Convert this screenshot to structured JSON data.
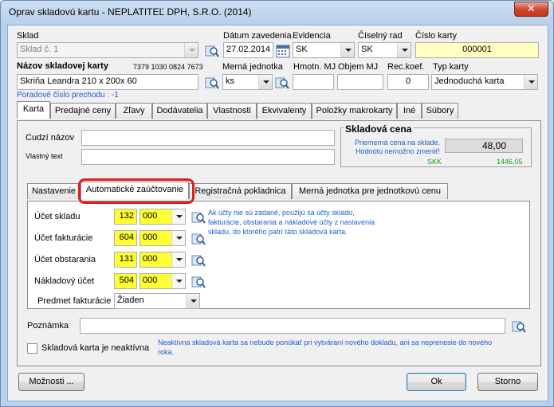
{
  "window": {
    "title": "Oprav skladovú kartu - NEPLATITEĽ DPH, S.R.O. (2014)",
    "close_glyph": "✕"
  },
  "header": {
    "sklad": {
      "label": "Sklad",
      "value": "Sklad č. 1"
    },
    "datum": {
      "label": "Dátum zavedenia",
      "value": "27.02.2014"
    },
    "evidencia": {
      "label": "Evidencia",
      "value": "SK"
    },
    "ciselny_rad": {
      "label": "Číselný rad",
      "value": "SK"
    },
    "cislo_karty": {
      "label": "Číslo karty",
      "value": "000001"
    },
    "nazov": {
      "label": "Názov skladovej karty",
      "barcode": "7379 1030 0824 7673",
      "value": "Skriňa Leandra 210 x 200x 60"
    },
    "merna_jednotka": {
      "label": "Merná jednotka",
      "value": "ks"
    },
    "hmotn_mj": {
      "label": "Hmotn. MJ",
      "value": ""
    },
    "objem_mj": {
      "label": "Objem MJ",
      "value": ""
    },
    "rec_koef": {
      "label": "Rec.koef.",
      "value": "0"
    },
    "typ_karty": {
      "label": "Typ karty",
      "value": "Jednoduchá karta"
    },
    "poradove_cislo": "Poradové číslo prechodu : -1"
  },
  "tabs": [
    {
      "label": "Karta"
    },
    {
      "label": "Predajné ceny"
    },
    {
      "label": "Zľavy"
    },
    {
      "label": "Dodávatelia"
    },
    {
      "label": "Vlastnosti"
    },
    {
      "label": "Ekvivalenty"
    },
    {
      "label": "Položky makrokarty"
    },
    {
      "label": "Iné"
    },
    {
      "label": "Súbory"
    }
  ],
  "karta": {
    "cudzi_nazov": {
      "label": "Cudzí názov",
      "value": ""
    },
    "vlastny_text": {
      "label": "Vlastný text",
      "value": ""
    },
    "skladova_cena": {
      "title": "Skladová cena",
      "note": "Priemerná cena na sklade. Hodnotu nemožno zmeniť!",
      "value": "48,00",
      "currency": "SKK",
      "converted": "1446,05"
    }
  },
  "subtabs": [
    {
      "label": "Nastavenie"
    },
    {
      "label": "Automatické zaúčtovanie"
    },
    {
      "label": "Registračná pokladnica"
    },
    {
      "label": "Merná jednotka pre jednotkovú cenu"
    }
  ],
  "auto": {
    "rows": [
      {
        "label": "Účet skladu",
        "syn": "132",
        "anal": "000"
      },
      {
        "label": "Účet fakturácie",
        "syn": "604",
        "anal": "000"
      },
      {
        "label": "Účet obstarania",
        "syn": "131",
        "anal": "000"
      },
      {
        "label": "Nákladový účet",
        "syn": "504",
        "anal": "000"
      }
    ],
    "note": "Ak účty nie sú zadané, použijú sa účty skladu, fakturácie, obstarania a nákladové účty z nastavenia skladu, do ktorého patrí táto skladová karta.",
    "predmet": {
      "label": "Predmet fakturácie",
      "value": "Žiaden"
    }
  },
  "poznamka": {
    "label": "Poznámka",
    "value": ""
  },
  "neaktivna": {
    "label": "Skladová karta je neaktívna",
    "checked": false,
    "note": "Neaktívna skladová karta sa nebude ponúkať pri vytváraní nového dokladu, ani sa neprenesie do nového roka."
  },
  "buttons": {
    "moznosti": "Možnosti ...",
    "ok": "Ok",
    "storno": "Storno"
  },
  "colors": {
    "accent_blue": "#1d5fd1",
    "highlight_red": "#e01e1e",
    "input_yellow": "#ffff33"
  }
}
